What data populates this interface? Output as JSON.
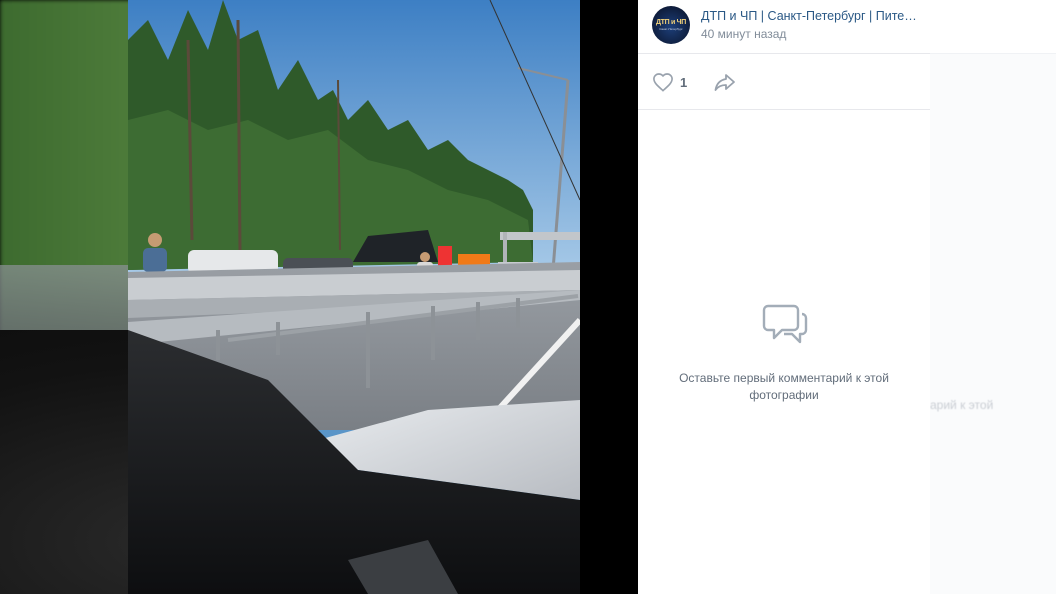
{
  "post": {
    "group_name": "ДТП и ЧП | Санкт-Петербург | Питер Онлайн",
    "time": "40 минут назад",
    "avatar_text_main": "ДТП и ЧП",
    "avatar_text_sub": "Санкт-Петербург"
  },
  "actions": {
    "like_count": "1"
  },
  "comments": {
    "empty_text": "Оставьте первый комментарий к этой фотографии"
  },
  "background_ghost": {
    "text": "арий к этой"
  },
  "colors": {
    "link": "#2a5885",
    "secondary": "#818c99",
    "icon": "#99a2ad"
  },
  "icons": {
    "like": "heart-icon",
    "share": "share-arrow-icon",
    "empty": "comment-bubbles-icon"
  }
}
